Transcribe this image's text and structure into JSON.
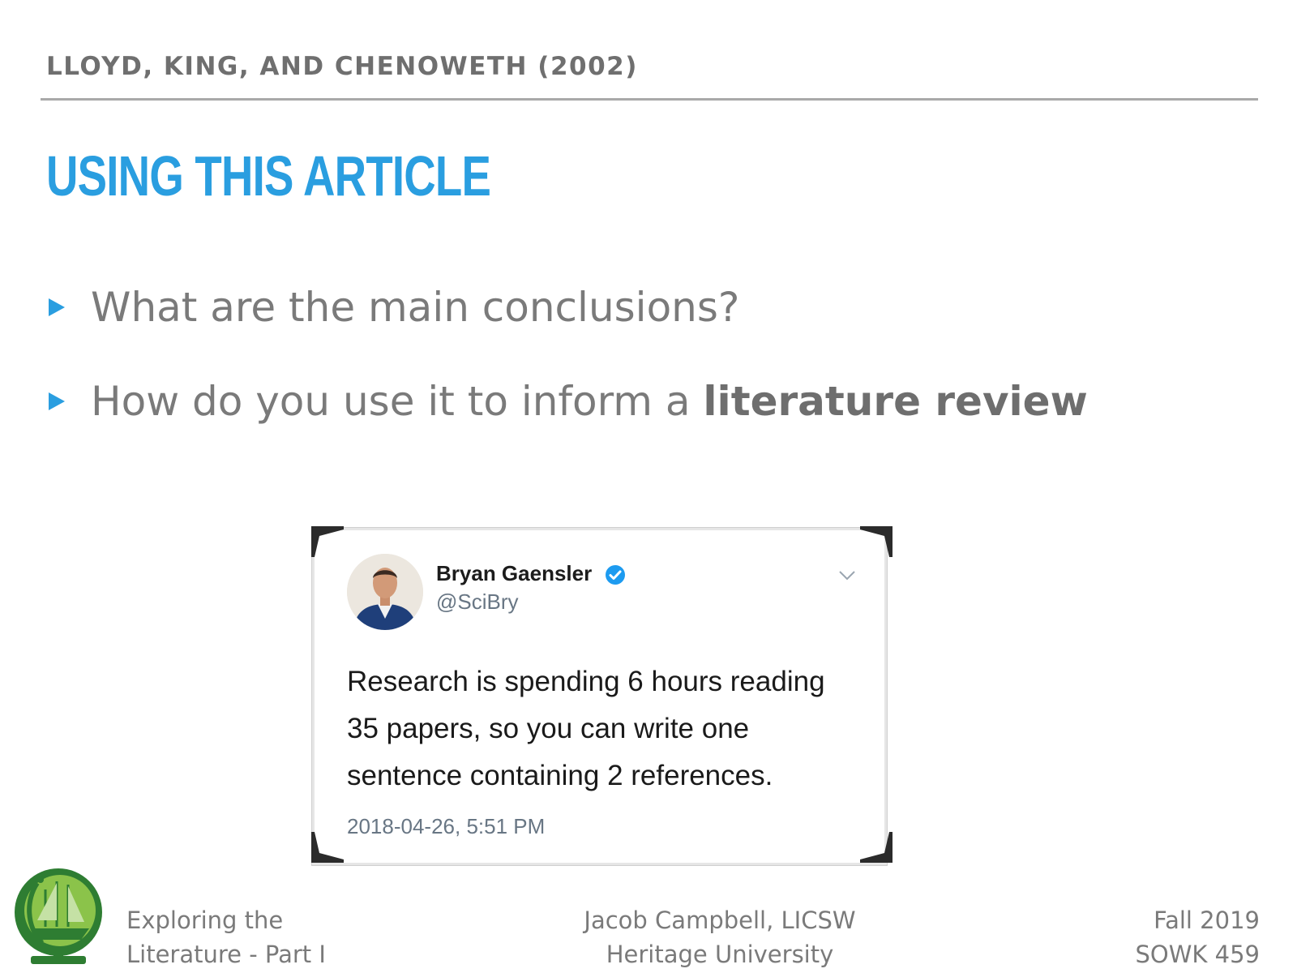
{
  "slide": {
    "header": "LLOYD, KING, AND CHENOWETH (2002)",
    "title": "USING THIS ARTICLE",
    "bullets": [
      {
        "text": "What are the main conclusions?"
      },
      {
        "text_before": "How do you use it to inform a ",
        "bold": "literature review"
      }
    ]
  },
  "tweet": {
    "name": "Bryan Gaensler",
    "handle": "@SciBry",
    "verified": true,
    "body_lines": [
      "Research is spending 6 hours reading",
      "35 papers, so you can write one",
      "sentence containing 2 references."
    ],
    "timestamp": "2018-04-26, 5:51 PM"
  },
  "footer": {
    "left_lines": [
      "Exploring the",
      "Literature - Part I"
    ],
    "center_lines": [
      "Jacob Campbell, LICSW",
      "Heritage University"
    ],
    "right_lines": [
      "Fall 2019",
      "SOWK 459"
    ]
  },
  "icons": {
    "bullet": "triangle-right-icon",
    "verified": "verified-badge-icon",
    "menu": "chevron-down-icon",
    "logo": "globe-ship-logo"
  },
  "colors": {
    "accent": "#2a9ee0",
    "header_text": "#6f6f6f",
    "body_text": "#7a7a7a",
    "verified": "#1d9bf0",
    "logo_green": "#2e7d32"
  }
}
